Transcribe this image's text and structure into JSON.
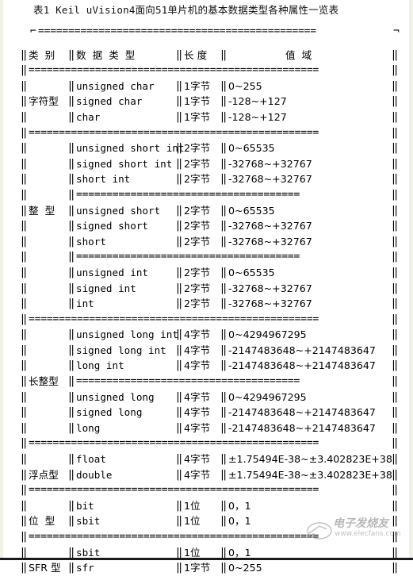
{
  "caption": "表1 Keil uVision4面向51单片机的基本数据类型各种属性一览表",
  "table": {
    "headers": {
      "category": "类  别",
      "datatype": "数  据  类  型",
      "length": "长 度",
      "range": "值  域"
    },
    "glyphs": {
      "rail": "‖",
      "sep_full": "================================================",
      "sep_inner": "=====================================",
      "top_rule": "==============================================",
      "corner_tl": "⌐",
      "corner_tr": "¬"
    },
    "groups": [
      {
        "label": "字符型",
        "label_row": 1,
        "rows": [
          {
            "type": "unsigned char",
            "length": "1字节",
            "range": "0~255"
          },
          {
            "type": "signed char",
            "length": "1字节",
            "range": "-128~+127"
          },
          {
            "type": "char",
            "length": "1字节",
            "range": "-128~+127"
          }
        ]
      },
      {
        "label": "整  型",
        "label_row": 4,
        "subgroups": [
          [
            {
              "type": "unsigned short int",
              "length": "2字节",
              "range": "0~65535"
            },
            {
              "type": "signed short int",
              "length": "2字节",
              "range": "-32768~+32767"
            },
            {
              "type": "short int",
              "length": "2字节",
              "range": "-32768~+32767"
            }
          ],
          [
            {
              "type": "unsigned short",
              "length": "2字节",
              "range": "0~65535"
            },
            {
              "type": "signed short",
              "length": "2字节",
              "range": "-32768~+32767"
            },
            {
              "type": "short",
              "length": "2字节",
              "range": "-32768~+32767"
            }
          ],
          [
            {
              "type": "unsigned int",
              "length": "2字节",
              "range": "0~65535"
            },
            {
              "type": "signed int",
              "length": "2字节",
              "range": "-32768~+32767"
            },
            {
              "type": "int",
              "length": "2字节",
              "range": "-32768~+32767"
            }
          ]
        ]
      },
      {
        "label": "长整型",
        "label_row": 3,
        "subgroups": [
          [
            {
              "type": "unsigned long int",
              "length": "4字节",
              "range": "0~4294967295"
            },
            {
              "type": "signed long int",
              "length": "4字节",
              "range": "-2147483648~+2147483647"
            },
            {
              "type": "long int",
              "length": "4字节",
              "range": "-2147483648~+2147483647"
            }
          ],
          [
            {
              "type": "unsigned long",
              "length": "4字节",
              "range": "0~4294967295"
            },
            {
              "type": "signed long",
              "length": "4字节",
              "range": "-2147483648~+2147483647"
            },
            {
              "type": "long",
              "length": "4字节",
              "range": "-2147483648~+2147483647"
            }
          ]
        ]
      },
      {
        "label": "浮点型",
        "label_row": 1,
        "rows": [
          {
            "type": "float",
            "length": "4字节",
            "range": "±1.75494E-38~±3.402823E+38"
          },
          {
            "type": "double",
            "length": "4字节",
            "range": "±1.75494E-38~±3.402823E+38"
          }
        ]
      },
      {
        "label": "位  型",
        "label_row": 1,
        "rows": [
          {
            "type": "bit",
            "length": "1位",
            "range": "0，1"
          },
          {
            "type": "sbit",
            "length": "1位",
            "range": "0，1"
          }
        ]
      },
      {
        "label": "SFR 型",
        "label_row": 1,
        "rows": [
          {
            "type": "sbit",
            "length": "1位",
            "range": "0，1"
          },
          {
            "type": "sfr",
            "length": "1字节",
            "range": "0~255"
          }
        ]
      }
    ]
  },
  "watermark": {
    "text": "电子发烧友",
    "url": "www.elecfans.com"
  }
}
